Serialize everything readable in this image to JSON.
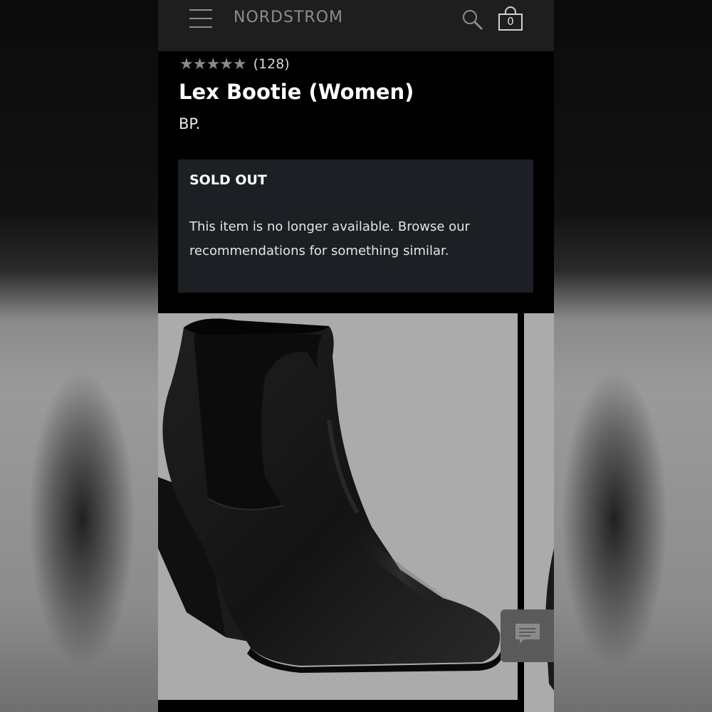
{
  "header": {
    "brand": "NORDSTROM",
    "menu_icon": "hamburger-menu-icon",
    "search_icon": "search-icon",
    "bag_icon": "shopping-bag-icon",
    "bag_count": "0"
  },
  "product": {
    "rating_stars": "★★★★★",
    "rating_value": 5,
    "review_count": "(128)",
    "title": "Lex Bootie (Women)",
    "brand": "BP."
  },
  "availability": {
    "status": "SOLD OUT",
    "message": "This item is no longer available. Browse our recommendations for something similar."
  },
  "gallery": {
    "main_image": "black-ankle-bootie-photo",
    "next_image": "next-product-photo-peek"
  },
  "chat": {
    "icon": "chat-bubble-icon"
  },
  "colors": {
    "header_bg": "#1e1e1e",
    "page_bg": "#000000",
    "sold_box_bg": "#1c2024",
    "image_bg": "#ababab",
    "muted_text": "#8c8c8c"
  }
}
